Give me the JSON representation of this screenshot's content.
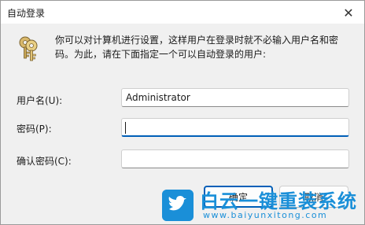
{
  "window": {
    "title": "自动登录",
    "close_glyph": "✕"
  },
  "description": "你可以对计算机进行设置，这样用户在登录时就不必输入用户名和密码。为此，请在下面指定一个可以自动登录的用户:",
  "icons": {
    "key": "keys-icon",
    "close": "close-icon",
    "bird": "bird-icon"
  },
  "fields": {
    "username": {
      "label": "用户名(U):",
      "value": "Administrator"
    },
    "password": {
      "label": "密码(P):",
      "value": ""
    },
    "confirm": {
      "label": "确认密码(C):",
      "value": ""
    }
  },
  "buttons": {
    "ok": "确定",
    "cancel": "取消"
  },
  "watermark": {
    "title": "白云一键重装系统",
    "url": "www.baiyunxitong.com"
  },
  "colors": {
    "accent": "#005fb8",
    "watermark": "#1a8fd8"
  }
}
